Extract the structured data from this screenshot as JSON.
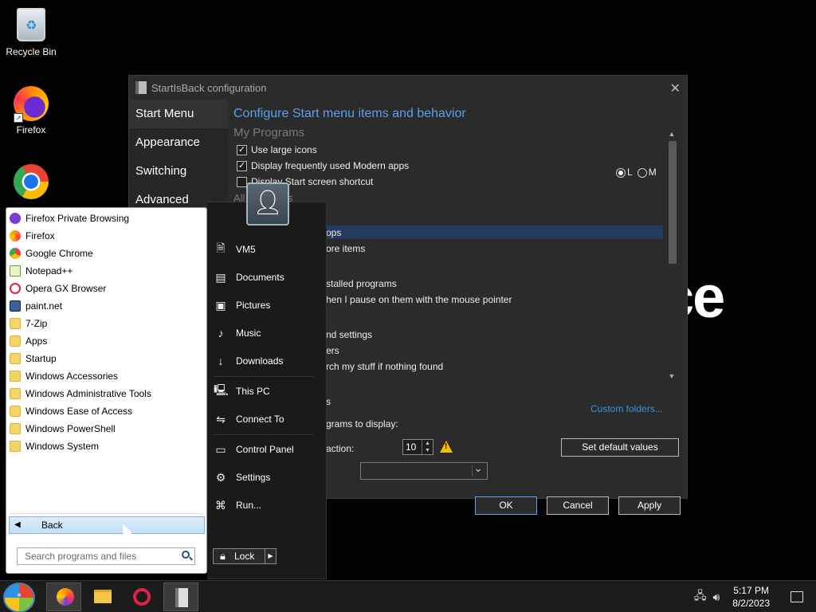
{
  "desktop": {
    "icons": [
      {
        "label": "Recycle Bin"
      },
      {
        "label": "Firefox"
      },
      {
        "label": "Google Chrome"
      }
    ],
    "bg_text": "ce"
  },
  "config": {
    "title": "StartIsBack configuration",
    "sidebar": [
      "Start Menu",
      "Appearance",
      "Switching",
      "Advanced"
    ],
    "heading": "Configure Start menu items and behavior",
    "section_programs": "My Programs",
    "checks": [
      {
        "label": "Use large icons",
        "checked": true
      },
      {
        "label": "Display frequently used Modern apps",
        "checked": true
      },
      {
        "label": "Display Start screen shortcut",
        "checked": false
      }
    ],
    "radio": {
      "l": "L",
      "m": "M"
    },
    "section_all": "All Programs",
    "fragments": {
      "f1": "ops",
      "f2": "ore items",
      "f3": "stalled programs",
      "f4": "hen I pause on them with the mouse pointer",
      "f5": "nd settings",
      "f6": "ers",
      "f7": "rch my stuff if nothing found",
      "f8": "s",
      "f9": "grams to display:",
      "f10": "action:"
    },
    "custom_folders": "Custom folders...",
    "spin_value": "10",
    "set_default": "Set default values",
    "ok": "OK",
    "cancel": "Cancel",
    "apply": "Apply"
  },
  "start_menu": {
    "programs": [
      {
        "label": "Firefox Private Browsing",
        "icon": "ffp"
      },
      {
        "label": "Firefox",
        "icon": "ff"
      },
      {
        "label": "Google Chrome",
        "icon": "gc"
      },
      {
        "label": "Notepad++",
        "icon": "np"
      },
      {
        "label": "Opera GX Browser",
        "icon": "op"
      },
      {
        "label": "paint.net",
        "icon": "pn"
      },
      {
        "label": "7-Zip",
        "icon": "fo"
      },
      {
        "label": "Apps",
        "icon": "fo"
      },
      {
        "label": "Startup",
        "icon": "fo"
      },
      {
        "label": "Windows Accessories",
        "icon": "fo"
      },
      {
        "label": "Windows Administrative Tools",
        "icon": "fo"
      },
      {
        "label": "Windows Ease of Access",
        "icon": "fo"
      },
      {
        "label": "Windows PowerShell",
        "icon": "fo"
      },
      {
        "label": "Windows System",
        "icon": "fo"
      }
    ],
    "back": "Back",
    "search_placeholder": "Search programs and files",
    "right": {
      "user": "VM5",
      "documents": "Documents",
      "pictures": "Pictures",
      "music": "Music",
      "downloads": "Downloads",
      "this_pc": "This PC",
      "connect_to": "Connect To",
      "control_panel": "Control Panel",
      "settings": "Settings",
      "run": "Run..."
    },
    "lock": "Lock"
  },
  "taskbar": {
    "time": "5:17 PM",
    "date": "8/2/2023"
  }
}
